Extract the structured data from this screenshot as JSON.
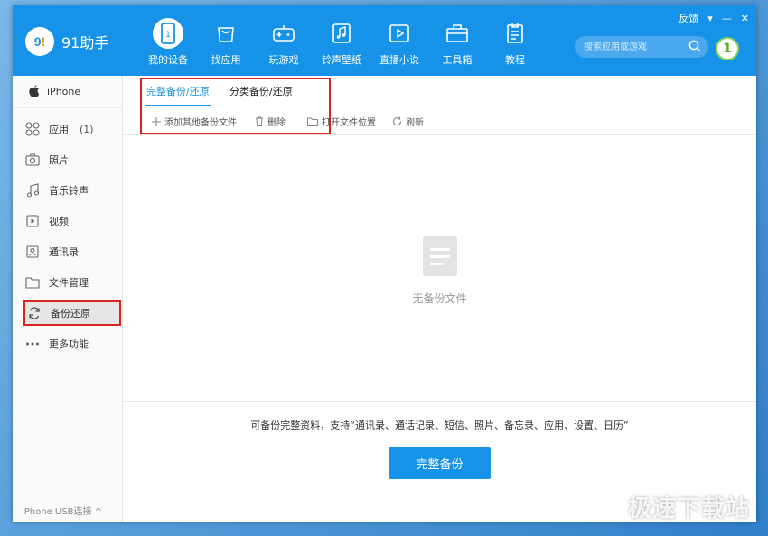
{
  "app": {
    "name": "91助手",
    "logo_text": "9",
    "logo_mark": "!"
  },
  "window_controls": {
    "feedback": "反馈",
    "menu": "▾",
    "minimize": "—",
    "close": "✕"
  },
  "nav": [
    {
      "label": "我的设备",
      "icon": "device-icon"
    },
    {
      "label": "找应用",
      "icon": "bag-icon"
    },
    {
      "label": "玩游戏",
      "icon": "gamepad-icon"
    },
    {
      "label": "铃声壁纸",
      "icon": "music-icon"
    },
    {
      "label": "直播小说",
      "icon": "play-icon"
    },
    {
      "label": "工具箱",
      "icon": "toolbox-icon"
    },
    {
      "label": "教程",
      "icon": "tutorial-icon"
    }
  ],
  "search": {
    "placeholder": "搜索应用或游戏"
  },
  "badge": {
    "value": "1"
  },
  "sidebar": {
    "device": "iPhone",
    "items": [
      {
        "label": "应用",
        "count": "(1)",
        "icon": "apps-icon"
      },
      {
        "label": "照片",
        "icon": "camera-icon"
      },
      {
        "label": "音乐铃声",
        "icon": "music-note-icon"
      },
      {
        "label": "视频",
        "icon": "video-icon"
      },
      {
        "label": "通讯录",
        "icon": "contacts-icon"
      },
      {
        "label": "文件管理",
        "icon": "folder-icon"
      },
      {
        "label": "备份还原",
        "icon": "sync-icon"
      },
      {
        "label": "更多功能",
        "icon": "more-icon"
      }
    ],
    "footer": "iPhone  USB连接 ^"
  },
  "tabs": {
    "full": "完整备份/还原",
    "category": "分类备份/还原"
  },
  "toolbar": {
    "add": "添加其他备份文件",
    "delete": "删除",
    "open": "打开文件位置",
    "refresh": "刷新"
  },
  "empty": {
    "text": "无备份文件"
  },
  "bottom": {
    "description": "可备份完整资料，支持“通讯录、通话记录、短信、照片、备忘录、应用、设置、日历”",
    "button": "完整备份"
  },
  "watermark": "极速下载站",
  "colors": {
    "primary": "#1693e8",
    "highlight": "#d9261c"
  }
}
